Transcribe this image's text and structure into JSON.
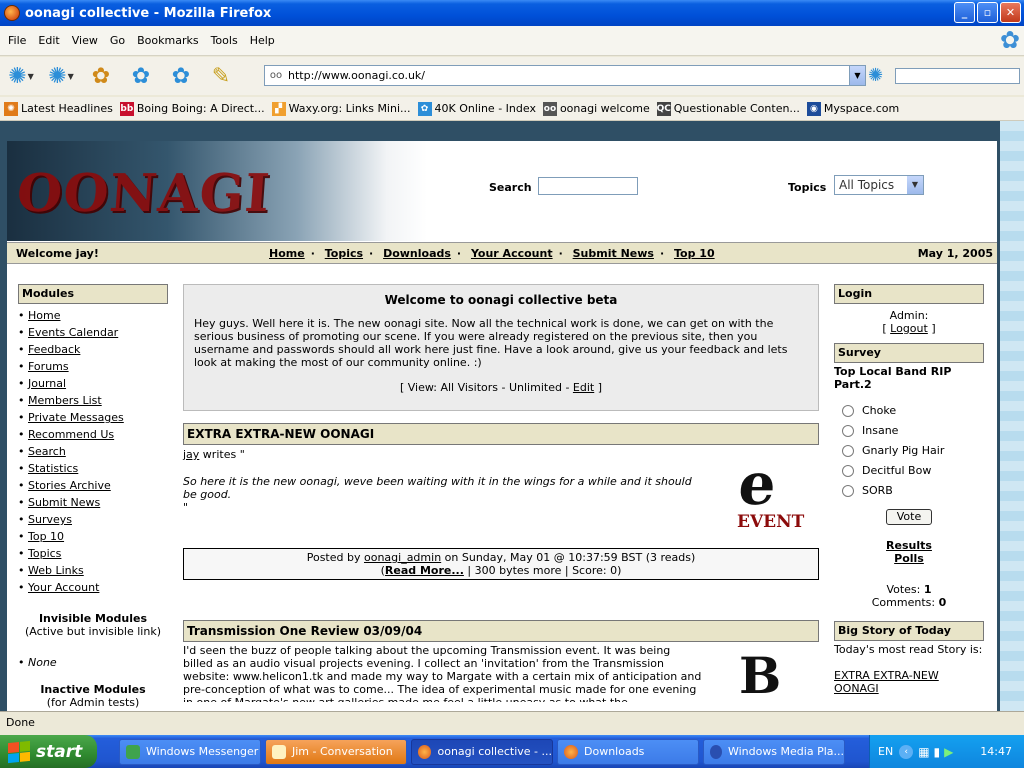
{
  "window": {
    "title": "oonagi collective - Mozilla Firefox",
    "buttons": {
      "minimize": "_",
      "maximize": "▫",
      "close": "✕"
    }
  },
  "menu": [
    "File",
    "Edit",
    "View",
    "Go",
    "Bookmarks",
    "Tools",
    "Help"
  ],
  "toolbar": {
    "url": "http://www.oonagi.co.uk/",
    "search_value": ""
  },
  "bookmarks": [
    {
      "label": "Latest Headlines",
      "icon": "rss-icon",
      "color": "#e07b1a",
      "glyph": "✺"
    },
    {
      "label": "Boing Boing: A Direct...",
      "icon": "boingboing-icon",
      "color": "#c8102e",
      "glyph": "bb"
    },
    {
      "label": "Waxy.org: Links Mini...",
      "icon": "waxy-icon",
      "color": "#f0a030",
      "glyph": "▞"
    },
    {
      "label": "40K Online - Index",
      "icon": "paw-icon",
      "color": "#2c8ed8",
      "glyph": "✿"
    },
    {
      "label": "oonagi welcome",
      "icon": "oonagi-icon",
      "color": "#555555",
      "glyph": "oo"
    },
    {
      "label": "Questionable Conten...",
      "icon": "qc-icon",
      "color": "#444444",
      "glyph": "QC"
    },
    {
      "label": "Myspace.com",
      "icon": "myspace-icon",
      "color": "#1d4c9a",
      "glyph": "◉"
    }
  ],
  "site": {
    "logo_text": "OONAGI",
    "search_label": "Search",
    "topics_label": "Topics",
    "topics_selected": "All Topics",
    "welcome_user": "Welcome jay!",
    "nav": [
      "Home",
      "Topics",
      "Downloads",
      "Your Account",
      "Submit News",
      "Top 10"
    ],
    "date": "May 1, 2005"
  },
  "left": {
    "modules_title": "Modules",
    "modules": [
      "Home",
      "Events Calendar",
      "Feedback",
      "Forums",
      "Journal",
      "Members List",
      "Private Messages",
      "Recommend Us",
      "Search",
      "Statistics",
      "Stories Archive",
      "Submit News",
      "Surveys",
      "Top 10",
      "Topics",
      "Web Links",
      "Your Account"
    ],
    "invisible_title": "Invisible Modules",
    "invisible_note": "(Active but invisible link)",
    "invisible_item": "None",
    "inactive_title": "Inactive Modules",
    "inactive_note": "(for Admin tests)"
  },
  "center": {
    "welcome_title": "Welcome to oonagi collective beta",
    "welcome_text": "Hey guys. Well here it is. The new oonagi site. Now all the technical work is done, we can get on with the serious business of promoting our scene. If you were already registered on the previous site, then you username and passwords should all work here just fine. Have a look around, give us your feedback and lets look at making the most of our community online. :)",
    "view_prefix": "[ View: All Visitors - Unlimited - ",
    "view_edit": "Edit",
    "view_suffix": " ]",
    "story1": {
      "title": "EXTRA EXTRA-NEW OONAGI",
      "author": "jay",
      "writes": " writes \"",
      "quote": "So here it is the new oonagi, weve been waiting with it in the wings for a while and it should be good.",
      "close_quote": "\"",
      "image_label": "EVENT",
      "posted_prefix": "Posted by ",
      "posted_by": "oonagi_admin",
      "posted_suffix": " on Sunday, May 01 @ 10:37:59 BST (3 reads)",
      "read_more": "Read More...",
      "footer_rest": " | 300 bytes more | Score: 0)"
    },
    "story2": {
      "title": "Transmission One Review 03/09/04",
      "text": "I'd seen the buzz of people talking about the upcoming Transmission event. It was being billed as an audio visual projects evening. I collect an 'invitation' from the Transmission website: www.helicon1.tk and made my way to Margate with a certain mix of anticipation and pre-conception of what was to come... The idea of experimental music made for one evening in one of Margate's new art galleries made me feel a little uneasy as to what the"
    }
  },
  "right": {
    "login_title": "Login",
    "admin_label": "Admin:",
    "logout": "Logout",
    "survey_title": "Survey",
    "poll_question": "Top Local Band RIP Part.2",
    "poll_options": [
      "Choke",
      "Insane",
      "Gnarly Pig Hair",
      "Decitful Bow",
      "SORB"
    ],
    "vote_label": "Vote",
    "results": "Results",
    "polls": "Polls",
    "votes_label": "Votes: ",
    "votes_value": "1",
    "comments_label": "Comments: ",
    "comments_value": "0",
    "big_story_title": "Big Story of Today",
    "big_story_text": "Today's most read Story is:",
    "big_story_link": "EXTRA EXTRA-NEW OONAGI"
  },
  "statusbar": {
    "text": "Done"
  },
  "taskbar": {
    "start": "start",
    "tasks": [
      {
        "label": "Windows Messenger",
        "icon": "messenger-icon",
        "state": "normal"
      },
      {
        "label": "Jim - Conversation",
        "icon": "conversation-icon",
        "state": "flash"
      },
      {
        "label": "oonagi collective - ...",
        "icon": "firefox-icon",
        "state": "active"
      },
      {
        "label": "Downloads",
        "icon": "firefox-icon",
        "state": "normal"
      },
      {
        "label": "Windows Media Pla...",
        "icon": "media-player-icon",
        "state": "normal"
      }
    ],
    "lang": "EN",
    "clock": "14:47"
  }
}
